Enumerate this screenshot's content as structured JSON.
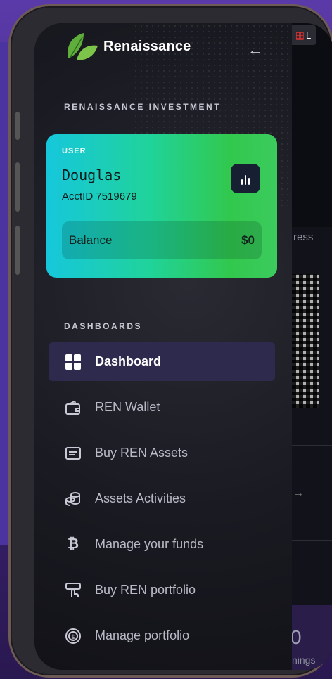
{
  "brand": {
    "name": "Renaissance"
  },
  "section": {
    "title": "RENAISSANCE INVESTMENT",
    "dashboards_title": "DASHBOARDS"
  },
  "user_card": {
    "user_label": "USER",
    "name": "Douglas",
    "account_id": "AcctID 7519679",
    "balance_label": "Balance",
    "balance_value": "$0"
  },
  "menu": {
    "items": [
      {
        "label": "Dashboard",
        "icon": "grid-icon",
        "active": true
      },
      {
        "label": "REN Wallet",
        "icon": "wallet-icon",
        "active": false
      },
      {
        "label": "Buy REN Assets",
        "icon": "card-icon",
        "active": false
      },
      {
        "label": "Assets Activities",
        "icon": "coins-icon",
        "active": false
      },
      {
        "label": "Manage your funds",
        "icon": "bitcoin-icon",
        "active": false
      },
      {
        "label": "Buy REN portfolio",
        "icon": "hand-tap-icon",
        "active": false
      },
      {
        "label": "Manage portfolio",
        "icon": "dollar-coin-icon",
        "active": false
      }
    ]
  },
  "background_page": {
    "flag_text": "L",
    "partial_text_1": "ress",
    "partial_text_2": "nings",
    "partial_text_3": "0"
  },
  "colors": {
    "accent": "#2e2a4e",
    "card_gradient_start": "#16c7dc",
    "card_gradient_end": "#3ccb5e",
    "frame": "#6e5b55"
  }
}
